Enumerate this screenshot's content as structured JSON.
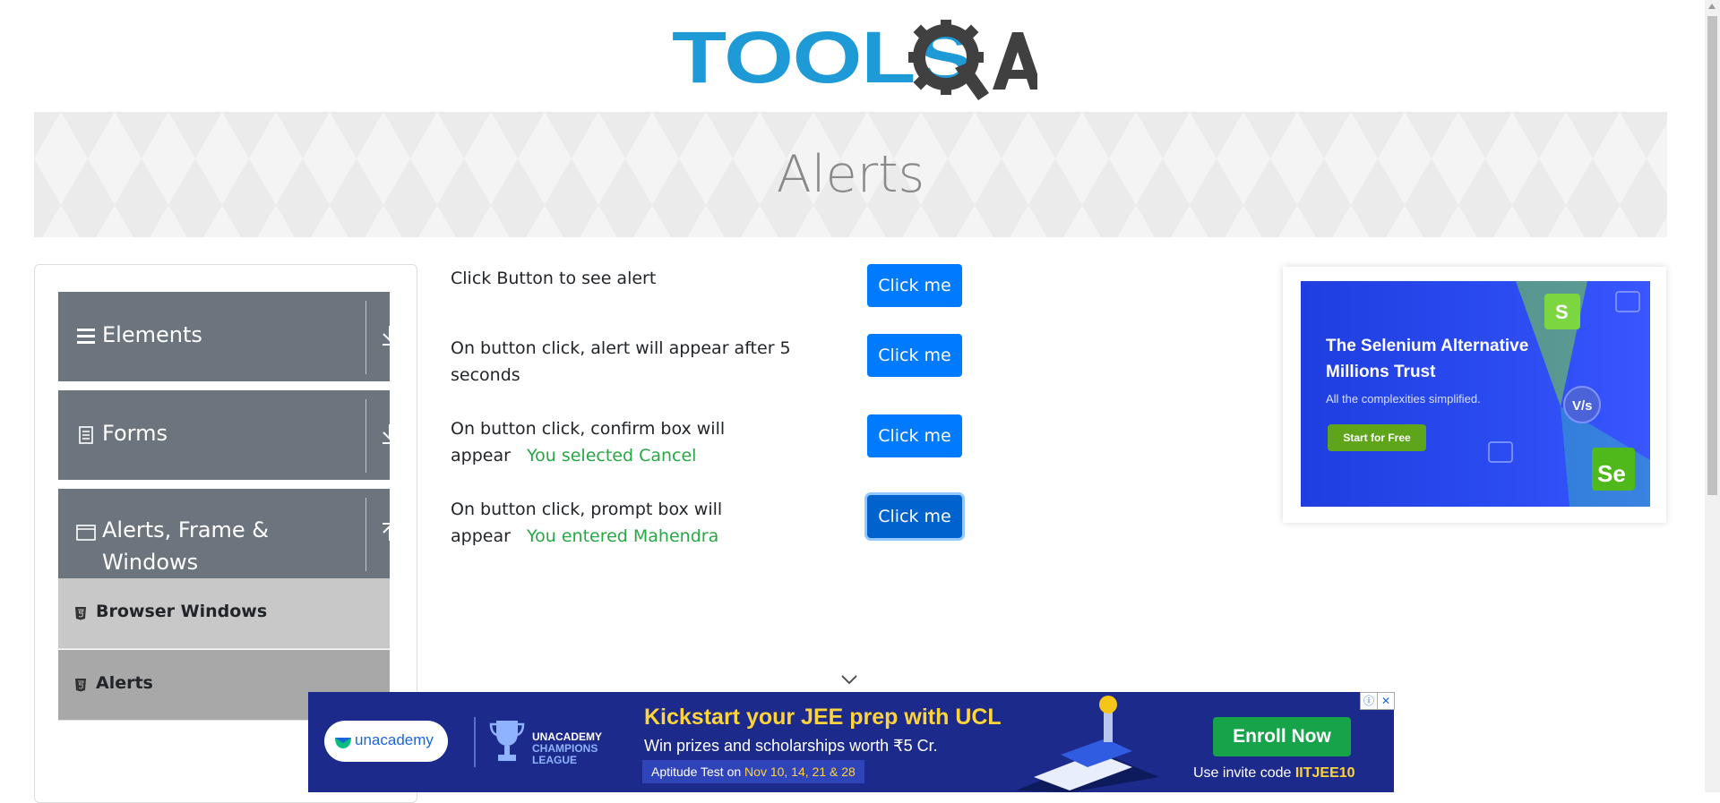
{
  "header": {
    "logo_text": "TOOLSQA"
  },
  "page": {
    "title": "Alerts"
  },
  "sidebar": {
    "groups": [
      {
        "label": "Elements",
        "expanded": false,
        "icon": "hamburger-icon"
      },
      {
        "label": "Forms",
        "expanded": false,
        "icon": "document-icon"
      },
      {
        "label": "Alerts, Frame & Windows",
        "expanded": true,
        "icon": "window-icon"
      }
    ],
    "items": [
      {
        "label": "Browser Windows",
        "active": false
      },
      {
        "label": "Alerts",
        "active": true
      }
    ]
  },
  "alerts": [
    {
      "text": "Click Button to see alert",
      "result": "",
      "button": "Click me"
    },
    {
      "text": "On button click, alert will appear after 5 seconds",
      "result": "",
      "button": "Click me"
    },
    {
      "text": "On button click, confirm box will appear",
      "result": "You selected Cancel",
      "button": "Click me"
    },
    {
      "text": "On button click, prompt box will appear",
      "result": "You entered Mahendra",
      "button": "Click me"
    }
  ],
  "side_ad": {
    "headline": "The Selenium Alternative Millions Trust",
    "subtext": "All the complexities simplified.",
    "cta": "Start for Free"
  },
  "bottom_ad": {
    "brand": "unacademy",
    "league": "UNACADEMY",
    "league_line2": "CHAMPIONS",
    "league_line3": "LEAGUE",
    "headline": "Kickstart your JEE prep with UCL",
    "subline": "Win prizes and scholarships worth ₹5 Cr.",
    "test_label": "Aptitude Test on",
    "test_dates": "Nov 10, 14, 21 & 28",
    "cta": "Enroll Now",
    "code_label": "Use invite code",
    "code": "IITJEE10"
  },
  "colors": {
    "accent": "#007bff",
    "success": "#28a745",
    "sidebar_group": "#6c757d"
  }
}
